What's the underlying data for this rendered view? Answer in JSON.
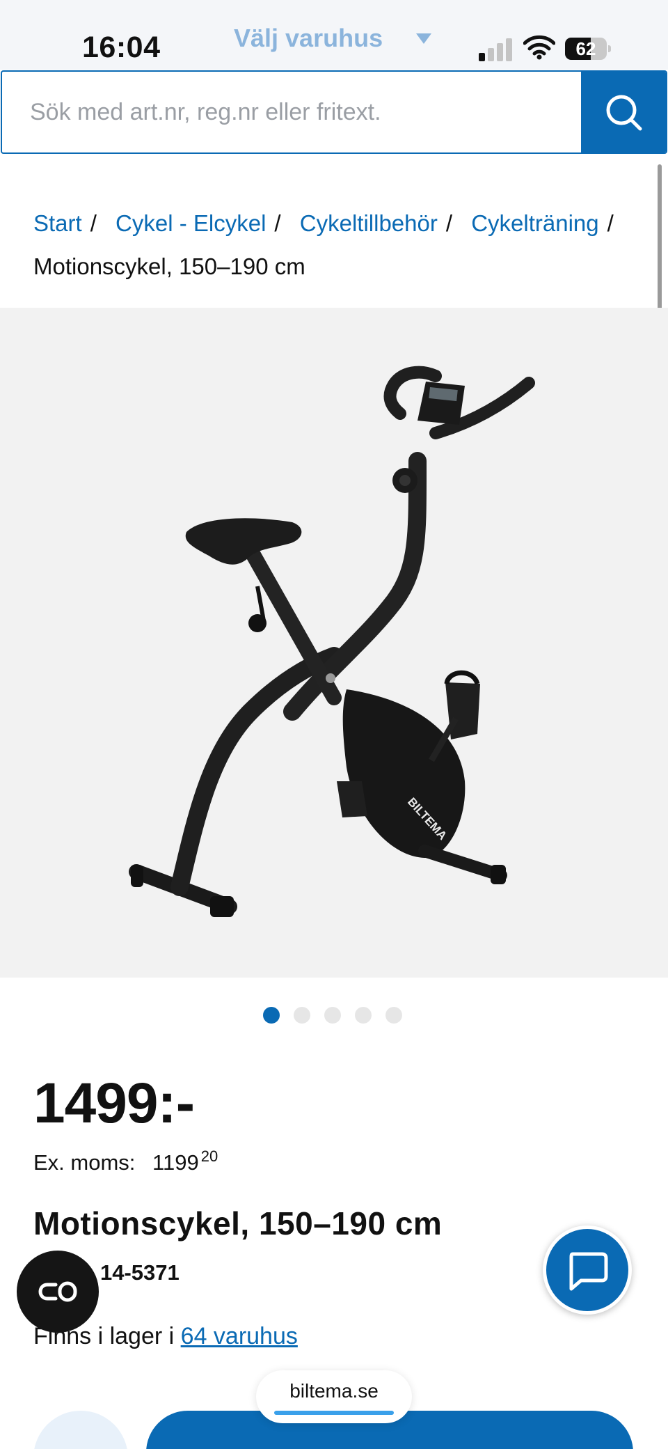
{
  "status_bar": {
    "time": "16:04",
    "store_selector": "Välj varuhus",
    "battery_percent": "62",
    "battery_level": 0.62
  },
  "search": {
    "placeholder": "Sök med art.nr, reg.nr eller fritext.",
    "value": ""
  },
  "breadcrumb": {
    "items": [
      "Start",
      "Cykel - Elcykel",
      "Cykeltillbehör",
      "Cykelträning"
    ],
    "separator": "/",
    "current": "Motionscykel, 150–190 cm"
  },
  "gallery": {
    "image_brand_text": "BILTEMA",
    "image_count": 5,
    "active_index": 0
  },
  "product": {
    "price": "1499:-",
    "ex_vat_label": "Ex. moms:",
    "ex_vat_amount": "1199",
    "ex_vat_cents": "20",
    "title": "Motionscykel, 150–190 cm",
    "article_number": "14-5371",
    "stock_prefix": "Finns i lager i",
    "stock_link": "64 varuhus"
  },
  "browser": {
    "url": "biltema.se"
  },
  "icons": {
    "search": "search-icon",
    "chat": "chat-icon",
    "compare": "compare-icon",
    "signal": "cellular-signal-icon",
    "wifi": "wifi-icon",
    "battery": "battery-icon",
    "caret": "caret-down-icon"
  },
  "colors": {
    "brand_blue": "#0a6ab4",
    "store_selector": "#8bb4dc",
    "gallery_bg": "#f2f2f2",
    "dot_inactive": "#e6e6e6"
  }
}
